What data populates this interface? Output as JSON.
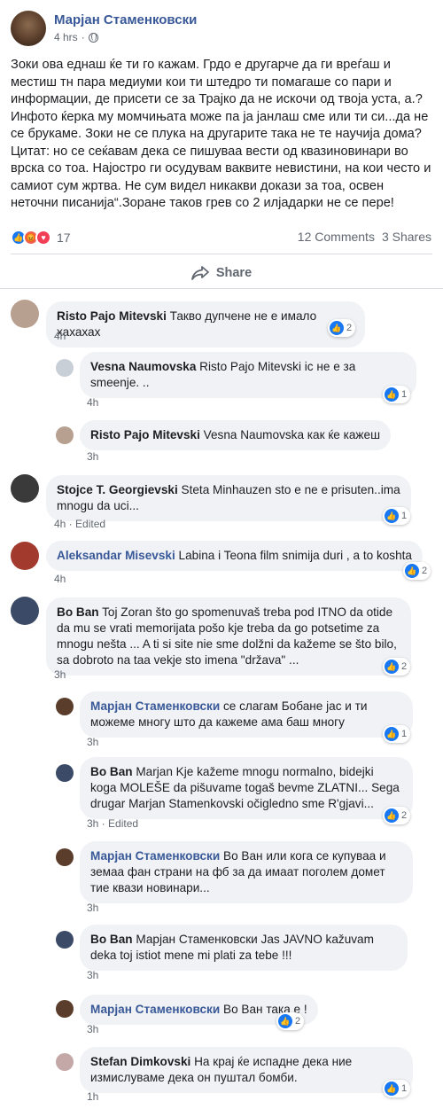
{
  "post": {
    "author": "Марјан Стаменковски",
    "time": "4 hrs",
    "privacy_separator": "·",
    "text": "Зоки ова еднаш ќе ти го кажам. Грдо е другарче да ги вреѓаш и местиш тн пара медиуми кои ти штедро ти помагаше со пари и информации, де присети се за Трајко да не искочи од твоја уста, а.? Инфото ќерка му момчињата може па ја јанлаш сме или ти си...да не се брукаме. Зоки не се плука на другарите така не те научија дома? Цитат: но се сеќавам дека се пишуваа вести од квазиновинари во врска со тоа. Најостро ги осудувам ваквите невистини, на кои често и самиот сум жртва. Не сум видел никакви докази за тоа, освен неточни писанија“.Зоране таков грев со 2 илјадарки не се пере!",
    "reaction_count": "17",
    "comments_count": "12 Comments",
    "shares_count": "3 Shares",
    "share_label": "Share"
  },
  "colors": {
    "link": "#385898",
    "like": "#1877f2",
    "bubble": "#f0f2f5",
    "meta": "#606770"
  },
  "comments": [
    {
      "name": "Risto Pajo Mitevski",
      "text": "Такво дупчене не е имало хахахах",
      "meta": "4h",
      "likes": "2"
    },
    {
      "name": "Vesna Naumovska",
      "text": "Risto Pajo Mitevski іс не е за smeenje. ..",
      "meta": "4h",
      "likes": "1"
    },
    {
      "name": "Risto Pajo Mitevski",
      "text": "Vesna Naumovska как ќе кажеш",
      "meta": "3h"
    },
    {
      "name": "Stojce T. Georgievski",
      "text": "Steta Minhauzen sto e ne e prisuten..ima mnogu da uci...",
      "meta": "4h · Edited",
      "likes": "1"
    },
    {
      "name": "Aleksandar Misevski",
      "text": "Labina i Teona film snimija duri , a to koshta",
      "meta": "4h",
      "likes": "2"
    },
    {
      "name": "Bo Ban",
      "text": "Toj Zoran što go spomenuvaš treba pod ITNO da otide da mu se vrati memorijata pošo kje treba da go potsetime za mnogu nešta ... A ti si site nie sme dolžni da kažeme se što bilo, sa dobroto na taa vekje sto imena \"država\" ...",
      "meta": "3h",
      "likes": "2"
    },
    {
      "name": "Марјан Стаменковски",
      "text": "се слагам Бобане јас и ти можеме многу што да кажеме ама баш многу",
      "meta": "3h",
      "likes": "1"
    },
    {
      "name": "Bo Ban",
      "text": "Marjan Kje kažeme mnogu normalno, bidejki koga MOLEŠE da pišuvame togaš bevme ZLATNI... Sega drugar Marjan Stamenkovski očigledno sme R'gjavi...",
      "meta": "3h · Edited",
      "likes": "2"
    },
    {
      "name": "Марјан Стаменковски",
      "text": "Во Ван или кога се купуваа и земаа фан страни на фб за да имаат поголем домет тие квази новинари...",
      "meta": "3h"
    },
    {
      "name": "Bo Ban",
      "text": "Марјан Стаменковски Jas JAVNO kažuvam deka toj istiot mene mi plati za tebe !!!",
      "meta": "3h"
    },
    {
      "name": "Марјан Стаменковски",
      "text": "Во Ван така е !",
      "meta": "3h",
      "likes": "2"
    },
    {
      "name": "Stefan Dimkovski",
      "text": "На крај ќе испадне дека ние измислуваме дека он пуштал бомби.",
      "meta": "1h",
      "likes": "1"
    }
  ]
}
